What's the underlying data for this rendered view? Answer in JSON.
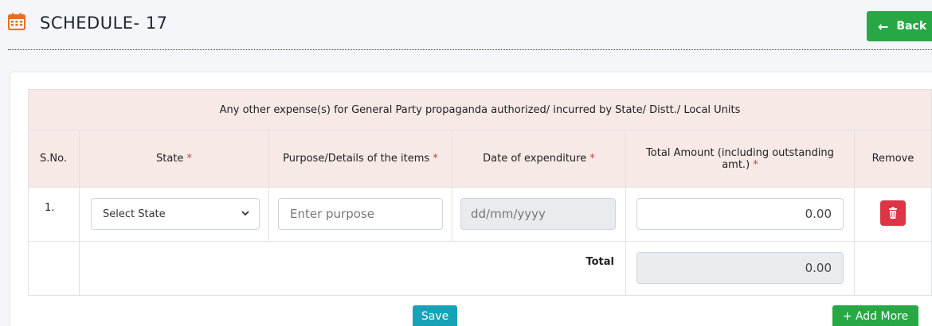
{
  "header": {
    "title": "SCHEDULE- 17",
    "back_label": "Back",
    "back_icon": "arrow-left-icon",
    "title_icon": "calendar-icon"
  },
  "table": {
    "caption": "Any other expense(s) for General Party propaganda authorized/ incurred by State/ Distt./ Local Units",
    "columns": {
      "sno": "S.No.",
      "state": "State",
      "purpose": "Purpose/Details of the items",
      "date": "Date of expenditure",
      "amount": "Total Amount (including outstanding amt.)",
      "remove": "Remove"
    },
    "required_mark": "*",
    "rows": [
      {
        "sno": "1.",
        "state_selected": "Select State",
        "purpose_placeholder": "Enter purpose",
        "date_placeholder": "dd/mm/yyyy",
        "amount": "0.00",
        "remove_icon": "trash-icon"
      }
    ],
    "total_label": "Total",
    "total_value": "0.00"
  },
  "actions": {
    "save_label": "Save",
    "add_more_label": "+ Add More"
  },
  "colors": {
    "header_bg": "#f7e9e6",
    "success": "#28a745",
    "info": "#17a2b8",
    "danger": "#dc3545",
    "calendar_icon": "#e8701a"
  }
}
